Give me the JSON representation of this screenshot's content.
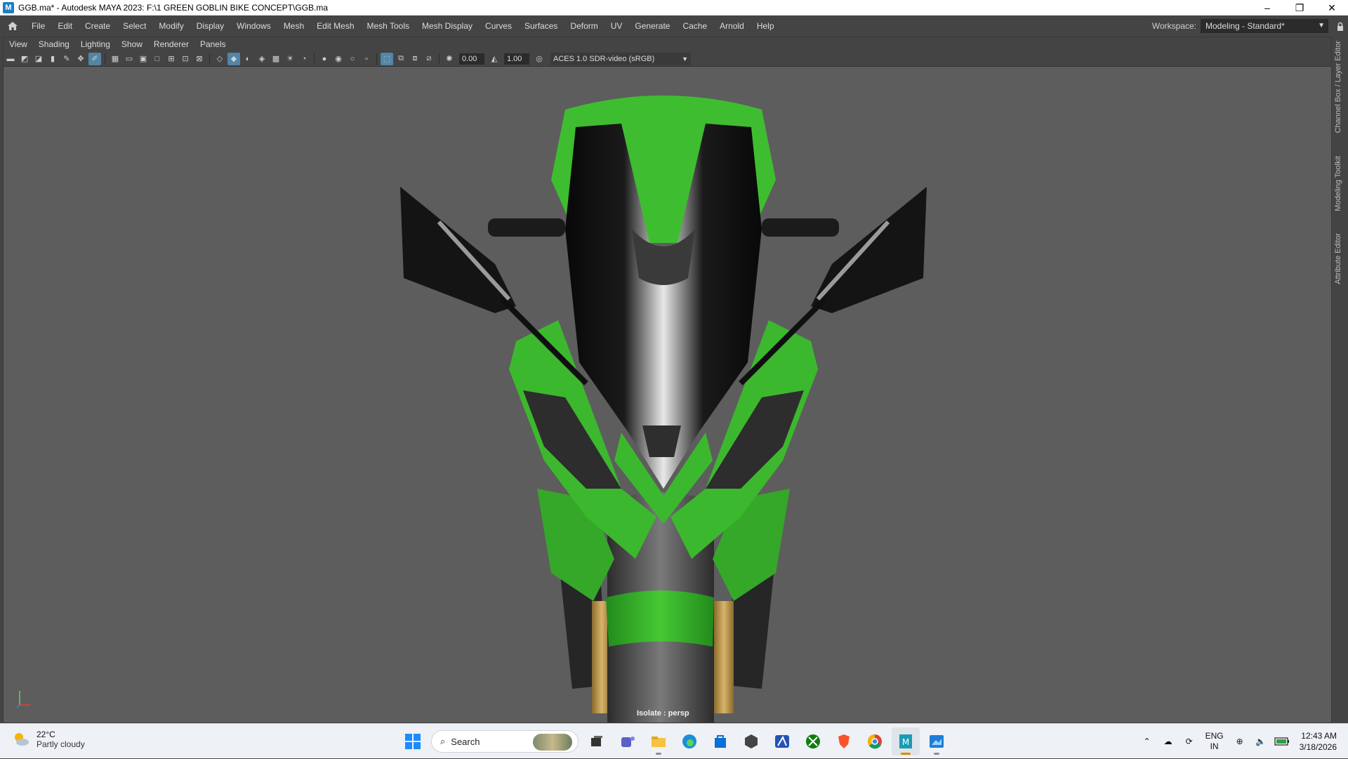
{
  "window": {
    "title": "GGB.ma* - Autodesk MAYA 2023: F:\\1 GREEN GOBLIN BIKE CONCEPT\\GGB.ma",
    "app_icon_letter": "M",
    "controls": {
      "minimize": "–",
      "restore": "❐",
      "close": "✕"
    }
  },
  "menubar": {
    "items": [
      "File",
      "Edit",
      "Create",
      "Select",
      "Modify",
      "Display",
      "Windows",
      "Mesh",
      "Edit Mesh",
      "Mesh Tools",
      "Mesh Display",
      "Curves",
      "Surfaces",
      "Deform",
      "UV",
      "Generate",
      "Cache",
      "Arnold",
      "Help"
    ],
    "workspace_label": "Workspace:",
    "workspace_value": "Modeling - Standard*"
  },
  "panel": {
    "menu": [
      "View",
      "Shading",
      "Lighting",
      "Show",
      "Renderer",
      "Panels"
    ],
    "exposure": "0.00",
    "gamma": "1.00",
    "color_management": "ACES 1.0 SDR-video (sRGB)",
    "isolate_label": "Isolate : persp"
  },
  "side_tabs": [
    "Channel Box / Layer Editor",
    "Modeling Toolkit",
    "Attribute Editor"
  ],
  "taskbar": {
    "weather": {
      "temp": "22°C",
      "condition": "Partly cloudy"
    },
    "search_placeholder": "Search",
    "apps": [
      "task-view",
      "teams",
      "file-explorer",
      "edge",
      "store",
      "unity",
      "affinity",
      "xbox",
      "brave",
      "chrome",
      "maya",
      "photos"
    ],
    "lang_line1": "ENG",
    "lang_line2": "IN",
    "time": "12:43 AM",
    "date": "3/18/2026"
  },
  "colors": {
    "bike_green": "#3cb82e",
    "bike_black": "#111111",
    "viewport_bg": "#5d5d5d",
    "ui_dark": "#444444"
  }
}
